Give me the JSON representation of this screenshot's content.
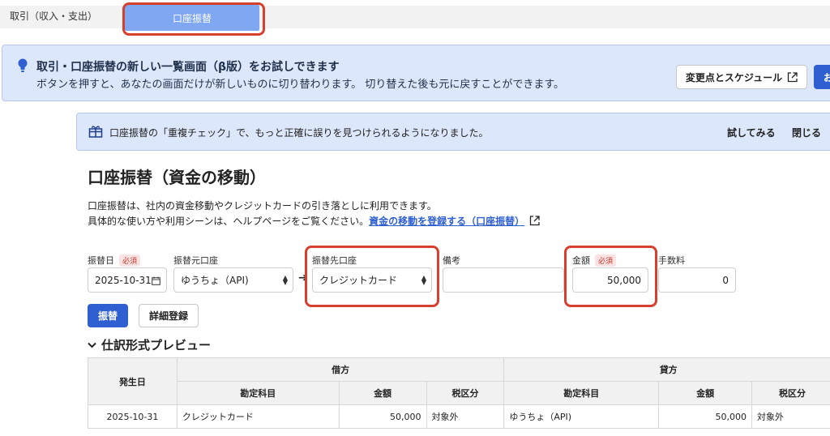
{
  "tabs": {
    "plain": "取引（収入・支出）",
    "active": "口座振替"
  },
  "beta_banner": {
    "icon": "lightbulb-icon",
    "title": "取引・口座振替の新しい一覧画面（β版）をお試しできます",
    "description": "ボタンを押すと、あなたの画面だけが新しいものに切り替わります。 切り替えた後も元に戻すことができます。",
    "changes_button": "変更点とスケジュール",
    "primary_button_partial": "お"
  },
  "notice": {
    "icon": "gift-icon",
    "text": "口座振替の「重複チェック」で、もっと正確に誤りを見つけられるようになりました。",
    "try_label": "試してみる",
    "close_label": "閉じる"
  },
  "page": {
    "title": "口座振替（資金の移動）",
    "desc1": "口座振替は、社内の資金移動やクレジットカードの引き落としに利用できます。",
    "desc2_prefix": "具体的な使い方や利用シーンは、ヘルプページをご覧ください。",
    "help_link": "資金の移動を登録する（口座振替）"
  },
  "form": {
    "required_badge": "必須",
    "date_label": "振替日",
    "date_value": "2025-10-31",
    "from_label": "振替元口座",
    "from_value": "ゆうちょ（API)",
    "to_label": "振替先口座",
    "to_value": "クレジットカード",
    "memo_label": "備考",
    "memo_value": "",
    "amount_label": "金額",
    "amount_value": "50,000",
    "fee_label": "手数料",
    "fee_value": "0",
    "submit_button": "振替",
    "detail_button": "詳細登録"
  },
  "preview": {
    "heading": "仕訳形式プレビュー",
    "col_date": "発生日",
    "debit": "借方",
    "credit": "貸方",
    "sub_account": "勘定科目",
    "sub_amount": "金額",
    "sub_tax": "税区分",
    "rows": [
      {
        "date": "2025-10-31",
        "debit_account": "クレジットカード",
        "debit_amount": "50,000",
        "debit_tax": "対象外",
        "credit_account": "ゆうちょ（API)",
        "credit_amount": "50,000",
        "credit_tax": "対象外"
      }
    ]
  },
  "colors": {
    "accent": "#2f5fd0",
    "tab_active": "#7fa7f2",
    "highlight": "#d6402f",
    "banner_bg": "#dde7fb"
  }
}
